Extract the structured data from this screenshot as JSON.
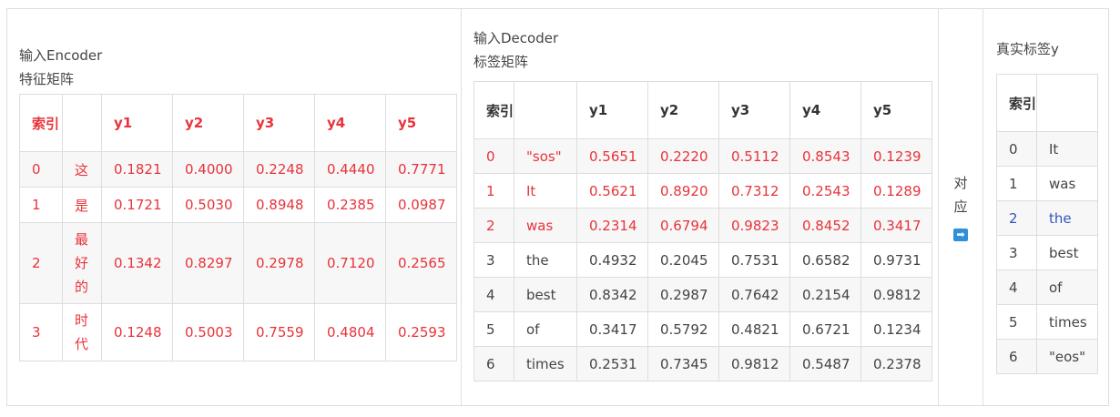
{
  "encoder": {
    "caption_line1": "输入Encoder",
    "caption_line2": "特征矩阵",
    "headers": [
      "索引",
      "",
      "y1",
      "y2",
      "y3",
      "y4",
      "y5"
    ],
    "rows": [
      [
        "0",
        "这",
        "0.1821",
        "0.4000",
        "0.2248",
        "0.4440",
        "0.7771"
      ],
      [
        "1",
        "是",
        "0.1721",
        "0.5030",
        "0.8948",
        "0.2385",
        "0.0987"
      ],
      [
        "2",
        "最好的",
        "0.1342",
        "0.8297",
        "0.2978",
        "0.7120",
        "0.2565"
      ],
      [
        "3",
        "时代",
        "0.1248",
        "0.5003",
        "0.7559",
        "0.4804",
        "0.2593"
      ]
    ]
  },
  "decoder": {
    "caption_line1": "输入Decoder",
    "caption_line2": "标签矩阵",
    "headers": [
      "索引",
      "",
      "y1",
      "y2",
      "y3",
      "y4",
      "y5"
    ],
    "rows": [
      [
        "0",
        "\"sos\"",
        "0.5651",
        "0.2220",
        "0.5112",
        "0.8543",
        "0.1239"
      ],
      [
        "1",
        "It",
        "0.5621",
        "0.8920",
        "0.7312",
        "0.2543",
        "0.1289"
      ],
      [
        "2",
        "was",
        "0.2314",
        "0.6794",
        "0.9823",
        "0.8452",
        "0.3417"
      ],
      [
        "3",
        "the",
        "0.4932",
        "0.2045",
        "0.7531",
        "0.6582",
        "0.9731"
      ],
      [
        "4",
        "best",
        "0.8342",
        "0.2987",
        "0.7642",
        "0.2154",
        "0.9812"
      ],
      [
        "5",
        "of",
        "0.3417",
        "0.5792",
        "0.4821",
        "0.6721",
        "0.1234"
      ],
      [
        "6",
        "times",
        "0.2531",
        "0.7345",
        "0.9812",
        "0.5487",
        "0.2378"
      ]
    ]
  },
  "middle": {
    "label_1": "对",
    "label_2": "应",
    "arrow_glyph": "➡"
  },
  "labels": {
    "caption": "真实标签y",
    "headers": [
      "索引",
      ""
    ],
    "rows": [
      [
        "0",
        "It"
      ],
      [
        "1",
        "was"
      ],
      [
        "2",
        "the"
      ],
      [
        "3",
        "best"
      ],
      [
        "4",
        "of"
      ],
      [
        "5",
        "times"
      ],
      [
        "6",
        "\"eos\""
      ]
    ]
  },
  "colors": {
    "highlight_red": "#e8333a",
    "highlight_blue": "#3355bb",
    "arrow_blue": "#2f8fd8"
  }
}
